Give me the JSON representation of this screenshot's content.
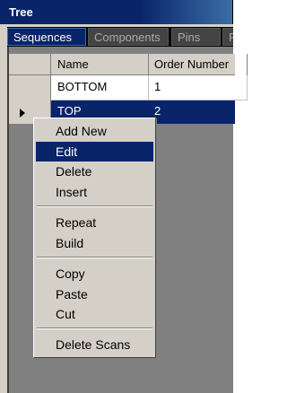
{
  "window": {
    "title": "Tree"
  },
  "tabs": [
    {
      "label": "Sequences"
    },
    {
      "label": "Components"
    },
    {
      "label": "Pins"
    },
    {
      "label": "F"
    }
  ],
  "grid": {
    "columns": [
      "Name",
      "Order Number"
    ],
    "rows": [
      {
        "name": "BOTTOM",
        "order": "1"
      },
      {
        "name": "TOP",
        "order": "2"
      }
    ]
  },
  "context_menu": {
    "items": [
      {
        "label": "Add New"
      },
      {
        "label": "Edit"
      },
      {
        "label": "Delete"
      },
      {
        "label": "Insert"
      },
      {
        "label": "Repeat"
      },
      {
        "label": "Build"
      },
      {
        "label": "Copy"
      },
      {
        "label": "Paste"
      },
      {
        "label": "Cut"
      },
      {
        "label": "Delete Scans"
      }
    ]
  }
}
